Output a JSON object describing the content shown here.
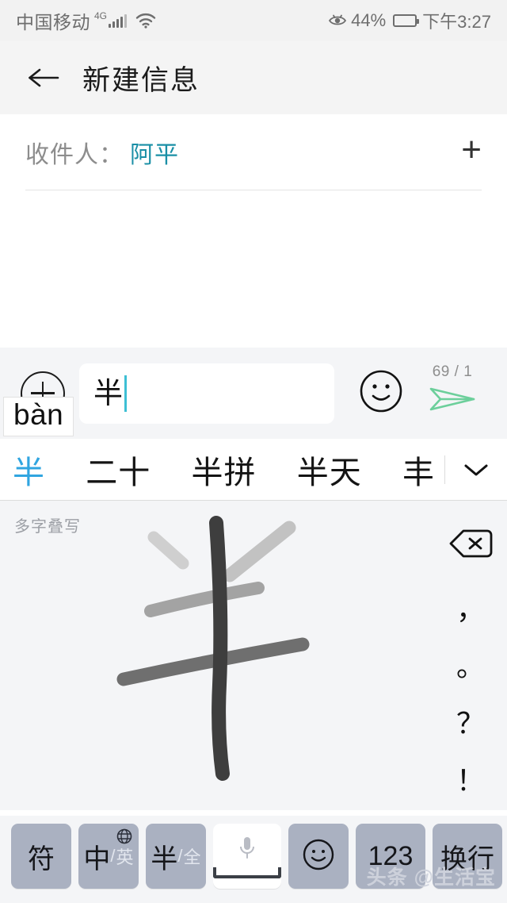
{
  "status_bar": {
    "carrier": "中国移动",
    "network_type": "4G",
    "battery_percent": "44%",
    "battery_level": 44,
    "time": "下午3:27",
    "icons": [
      "signal-icon",
      "wifi-icon",
      "eye-comfort-icon",
      "battery-icon"
    ]
  },
  "app_bar": {
    "back_label": "←",
    "title": "新建信息"
  },
  "recipient": {
    "label": "收件人：",
    "value": "阿平",
    "add_label": "+"
  },
  "input_row": {
    "pinyin_tip": "bàn",
    "text_value": "半",
    "char_count": "69 / 1",
    "plus_icon": "add-circle-icon",
    "emoji_icon": "smiley-icon",
    "send_icon": "send-plane-icon",
    "send_color": "#6ccf9b"
  },
  "candidates": {
    "items": [
      {
        "text": "半",
        "selected": true
      },
      {
        "text": "二十",
        "selected": false
      },
      {
        "text": "半拼",
        "selected": false
      },
      {
        "text": "半天",
        "selected": false
      },
      {
        "text": "丰",
        "selected": false
      }
    ],
    "expand_icon": "chevron-down-icon",
    "active_color": "#30a5e0"
  },
  "handwriting": {
    "hint": "多字叠写",
    "drawn_character": "半",
    "side_keys": [
      {
        "name": "backspace",
        "label": "⌫",
        "is_icon": true
      },
      {
        "name": "comma",
        "label": "，",
        "is_icon": false
      },
      {
        "name": "period",
        "label": "。",
        "is_icon": false
      },
      {
        "name": "question",
        "label": "？",
        "is_icon": false
      },
      {
        "name": "exclamation",
        "label": "！",
        "is_icon": false
      }
    ]
  },
  "keyboard_row": {
    "symbol_key": "符",
    "lang_key_main": "中",
    "lang_key_slash": "/",
    "lang_key_sub": "英",
    "width_key_main": "半",
    "width_key_slash": "/",
    "width_key_sub": "全",
    "space_icon": "microphone-icon",
    "emoji_key": "smiley-icon",
    "num_key": "123",
    "enter_key": "换行",
    "globe_icon": "globe-icon",
    "key_color": "#aab1c1"
  },
  "watermark": "头条 @生活宝"
}
